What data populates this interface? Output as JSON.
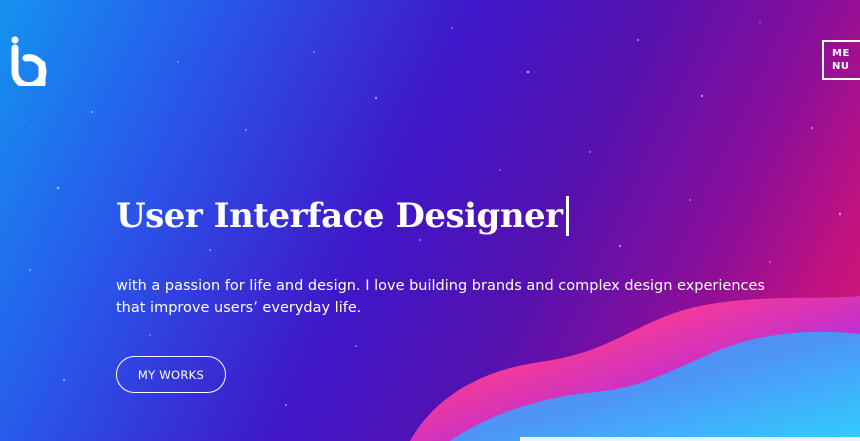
{
  "menu": {
    "label": "MENU"
  },
  "hero": {
    "headline": "User Interface Designer",
    "intro": "with a passion for life and design. I love building brands and complex design experiences that improve users’ everyday life.",
    "cta_label": "MY WORKS"
  },
  "icons": {
    "logo": "ia-monogram-logo",
    "cursor": "text-cursor"
  },
  "colors": {
    "gradient_blue": "#1493f0",
    "gradient_violet": "#3f16c9",
    "gradient_purple": "#5511ae",
    "gradient_magenta": "#c2127f",
    "gradient_pink": "#df1a6b",
    "text": "#ffffff"
  }
}
